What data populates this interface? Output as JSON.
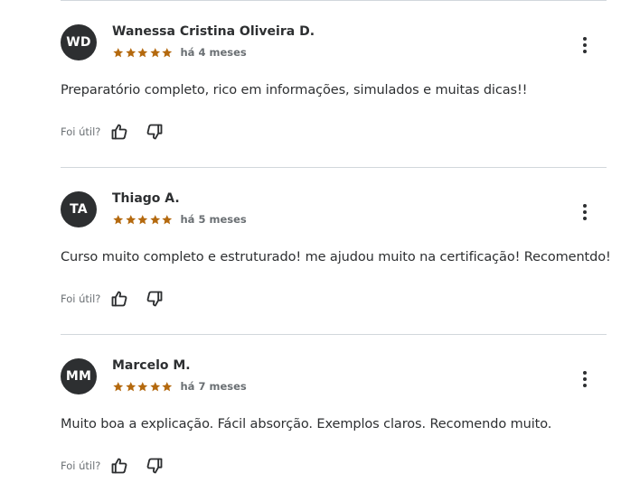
{
  "reviews": [
    {
      "initials": "WD",
      "name": "Wanessa Cristina Oliveira D.",
      "rating": 5,
      "time": "há 4 meses",
      "comment": "Preparatório completo, rico em informações, simulados e muitas dicas!!",
      "helpful_label": "Foi útil?"
    },
    {
      "initials": "TA",
      "name": "Thiago A.",
      "rating": 5,
      "time": "há 5 meses",
      "comment": "Curso muito completo e estruturado! me ajudou muito na certificação! Recomentdo!",
      "helpful_label": "Foi útil?"
    },
    {
      "initials": "MM",
      "name": "Marcelo M.",
      "rating": 5,
      "time": "há 7 meses",
      "comment": "Muito boa a explicação. Fácil absorção. Exemplos claros. Recomendo muito.",
      "helpful_label": "Foi útil?"
    }
  ],
  "icons": {
    "star": "star-icon",
    "more": "more-options-icon",
    "thumbs_up": "thumbs-up-icon",
    "thumbs_down": "thumbs-down-icon"
  },
  "colors": {
    "star": "#b4690e",
    "avatar_bg": "#2d2f31",
    "text": "#2d2f31",
    "muted": "#6a6f73",
    "divider": "#d1d7dc"
  }
}
